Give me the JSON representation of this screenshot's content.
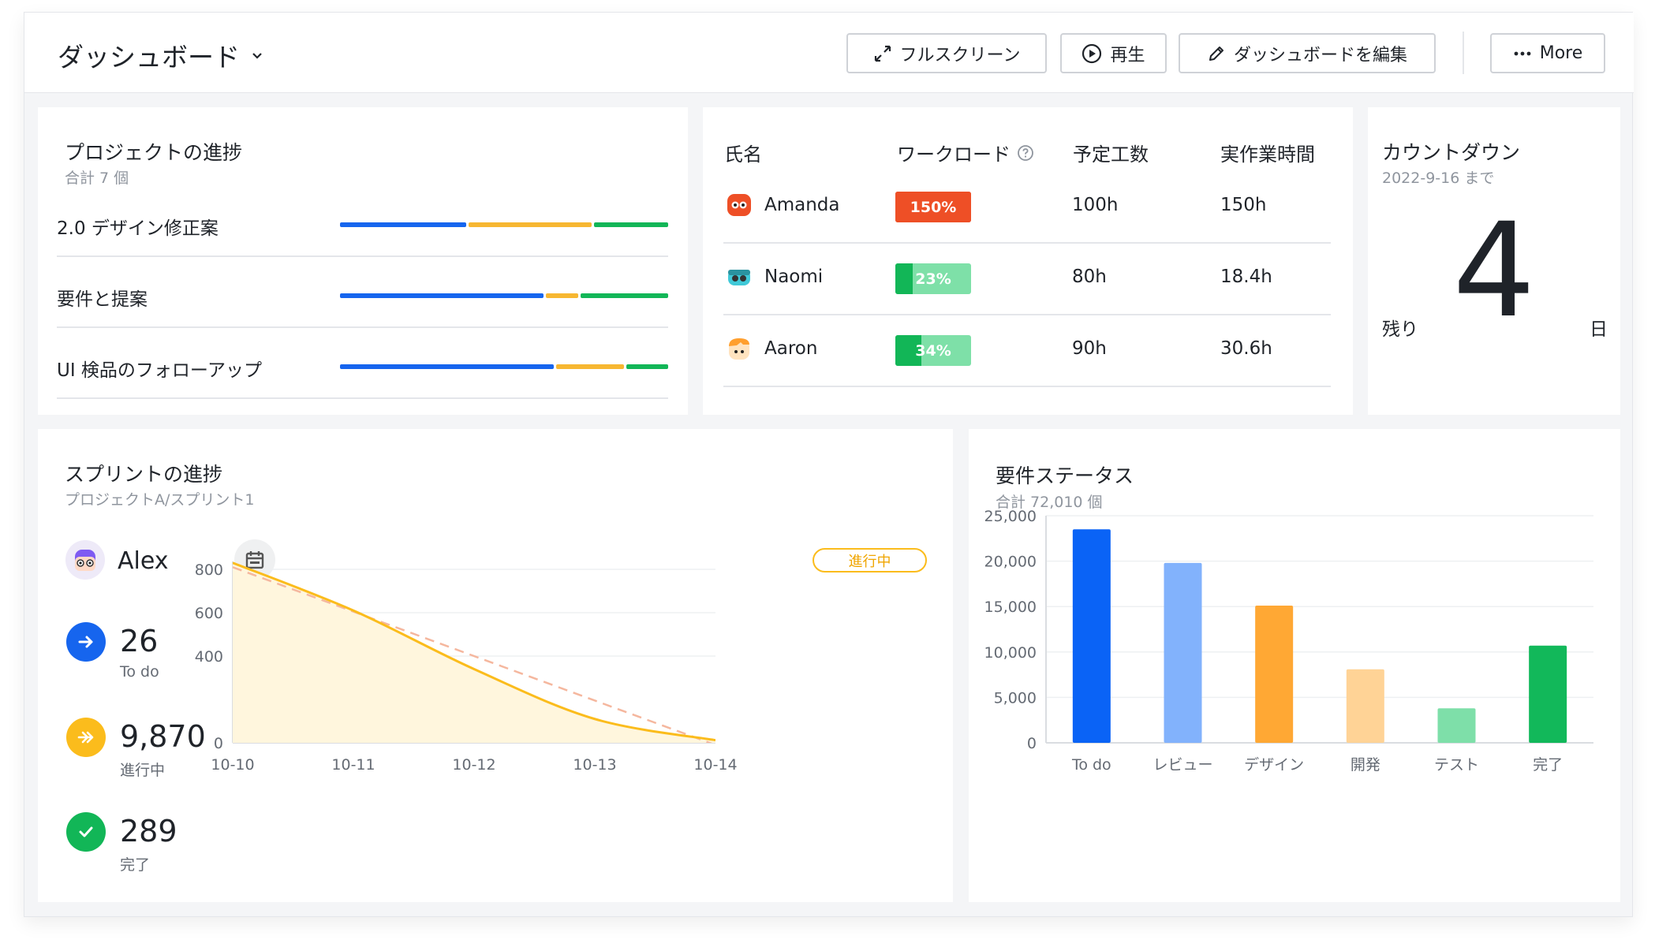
{
  "header": {
    "title": "ダッシュボード",
    "buttons": {
      "fullscreen": "フルスクリーン",
      "play": "再生",
      "edit": "ダッシュボードを編集",
      "more": "More"
    }
  },
  "project_progress": {
    "title": "プロジェクトの進捗",
    "subtitle": "合計 7 個",
    "items": [
      {
        "name": "2.0 デザイン修正案",
        "segments": [
          39,
          38,
          23
        ]
      },
      {
        "name": "要件と提案",
        "segments": [
          63,
          10,
          27
        ]
      },
      {
        "name": "UI 検品のフォローアップ",
        "segments": [
          66,
          21,
          13
        ]
      }
    ],
    "colors": [
      "#1665ee",
      "#f7b731",
      "#12b657"
    ]
  },
  "workload": {
    "headers": {
      "name": "氏名",
      "workload": "ワークロード",
      "planned": "予定工数",
      "actual": "実作業時間"
    },
    "rows": [
      {
        "name": "Amanda",
        "percent": "150%",
        "fill": 1.0,
        "planned": "100h",
        "actual": "150h",
        "bar_color": "#ee4f26",
        "track_color": "#ee4f26",
        "avatar": "red-avatar"
      },
      {
        "name": "Naomi",
        "percent": "23%",
        "fill": 0.23,
        "planned": "80h",
        "actual": "18.4h",
        "bar_color": "#12b657",
        "track_color": "#7ee0a8",
        "avatar": "teal-avatar"
      },
      {
        "name": "Aaron",
        "percent": "34%",
        "fill": 0.34,
        "planned": "90h",
        "actual": "30.6h",
        "bar_color": "#12b657",
        "track_color": "#7ee0a8",
        "avatar": "orange-avatar"
      }
    ]
  },
  "countdown": {
    "title": "カウントダウン",
    "subtitle": "2022-9-16 まで",
    "remaining_label": "残り",
    "value": "4",
    "unit": "日"
  },
  "sprint": {
    "title": "スプリントの進捗",
    "subtitle": "プロジェクトA/スプリント1",
    "user": "Alex",
    "status_badge": "進行中",
    "stats": [
      {
        "value": "26",
        "label": "To do",
        "color": "#1665ee",
        "icon": "arrow-right-icon"
      },
      {
        "value": "9,870",
        "label": "進行中",
        "color": "#fbbc1c",
        "icon": "double-arrow-icon"
      },
      {
        "value": "289",
        "label": "完了",
        "color": "#12b657",
        "icon": "check-icon"
      }
    ],
    "chart_data": {
      "type": "area",
      "x": [
        "10-10",
        "10-11",
        "10-12",
        "10-13",
        "10-14"
      ],
      "ylim": [
        0,
        800
      ],
      "yticks": [
        "800",
        "600",
        "400",
        "0"
      ],
      "yticks_values": [
        800,
        600,
        400,
        0
      ],
      "series": [
        {
          "style": "area",
          "color": "#fbbc1c",
          "fill": "#fff6dd",
          "values": [
            830,
            610,
            340,
            110,
            12
          ]
        },
        {
          "style": "dashed",
          "color": "#f5b79e",
          "values": [
            810,
            600,
            400,
            190,
            -10
          ]
        }
      ],
      "grid": true
    }
  },
  "requirements": {
    "title": "要件ステータス",
    "subtitle": "合計 72,010 個",
    "chart_data": {
      "type": "bar",
      "categories": [
        "To do",
        "レビュー",
        "デザイン",
        "開発",
        "テスト",
        "完了"
      ],
      "values": [
        23500,
        19800,
        15100,
        8100,
        3800,
        10700
      ],
      "colors": [
        "#0a63f6",
        "#82b2fc",
        "#ffa834",
        "#ffd396",
        "#7edfa9",
        "#12b85a"
      ],
      "ylim": [
        0,
        25000
      ],
      "yticks": [
        "25,000",
        "20,000",
        "15,000",
        "10,000",
        "5,000",
        "0"
      ],
      "yticks_values": [
        25000,
        20000,
        15000,
        10000,
        5000,
        0
      ],
      "grid": true
    }
  }
}
